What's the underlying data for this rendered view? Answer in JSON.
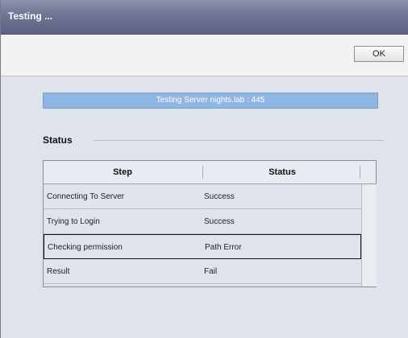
{
  "window": {
    "title": "Testing ..."
  },
  "toolbar": {
    "ok_label": "OK"
  },
  "progress": {
    "text": "Testing Server nights.lab : 445",
    "fraction": 1.0
  },
  "status_section": {
    "heading": "Status"
  },
  "table": {
    "columns": [
      "Step",
      "Status"
    ],
    "rows": [
      {
        "step": "Connecting To Server",
        "status": "Success"
      },
      {
        "step": "Trying to Login",
        "status": "Success"
      },
      {
        "step": "Checking permission",
        "status": "Path Error"
      },
      {
        "step": "Result",
        "status": "Fail"
      }
    ],
    "selected_row": 2
  }
}
